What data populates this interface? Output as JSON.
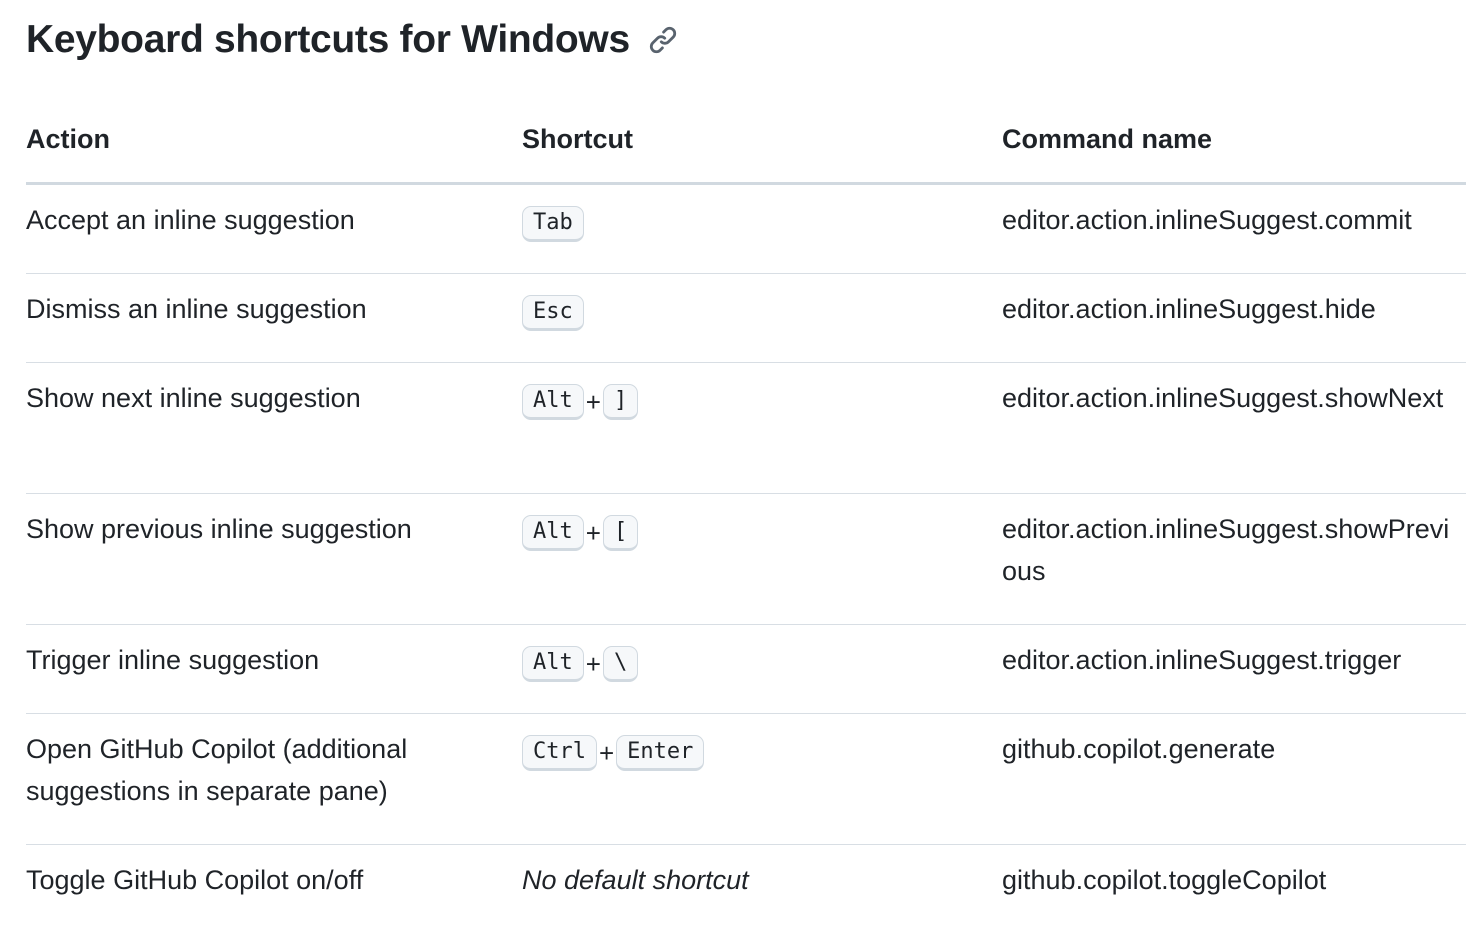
{
  "heading": {
    "title": "Keyboard shortcuts for Windows",
    "icon": "link-icon"
  },
  "table": {
    "headers": {
      "action": "Action",
      "shortcut": "Shortcut",
      "command": "Command name"
    },
    "rows": [
      {
        "action": "Accept an inline suggestion",
        "keys": [
          "Tab"
        ],
        "command": "editor.action.inlineSuggest.commit"
      },
      {
        "action": "Dismiss an inline suggestion",
        "keys": [
          "Esc"
        ],
        "command": "editor.action.inlineSuggest.hide"
      },
      {
        "action": "Show next inline suggestion",
        "keys": [
          "Alt",
          "]"
        ],
        "command": "editor.action.inlineSuggest.showNext"
      },
      {
        "action": "Show previous inline suggestion",
        "keys": [
          "Alt",
          "["
        ],
        "command": "editor.action.inlineSuggest.showPrevious"
      },
      {
        "action": "Trigger inline suggestion",
        "keys": [
          "Alt",
          "\\"
        ],
        "command": "editor.action.inlineSuggest.trigger"
      },
      {
        "action": "Open GitHub Copilot (additional suggestions in separate pane)",
        "keys": [
          "Ctrl",
          "Enter"
        ],
        "command": "github.copilot.generate"
      },
      {
        "action": "Toggle GitHub Copilot on/off",
        "keys": [],
        "shortcut_text": "No default shortcut",
        "command": "github.copilot.toggleCopilot"
      }
    ],
    "key_separator": "+"
  }
}
